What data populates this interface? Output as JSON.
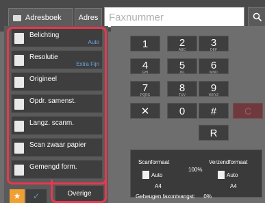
{
  "header": {
    "address_book_label": "Adresboek",
    "address_label": "Adres",
    "fax_placeholder": "Faxnummer"
  },
  "menu": [
    {
      "label": "Belichting",
      "value": "Auto",
      "icon": "exposure-icon"
    },
    {
      "label": "Resolutie",
      "value": "Extra Fijn",
      "icon": "resolution-icon"
    },
    {
      "label": "Origineel",
      "value": "",
      "icon": "original-icon"
    },
    {
      "label": "Opdr. samenst.",
      "value": "",
      "icon": "job-build-icon"
    },
    {
      "label": "Langz. scanm.",
      "value": "",
      "icon": "slow-scan-icon"
    },
    {
      "label": "Scan zwaar papier",
      "value": "",
      "icon": "thick-paper-icon"
    },
    {
      "label": "Gemengd form.",
      "value": "",
      "icon": "mixed-size-icon"
    }
  ],
  "footer_left": {
    "others_label": "Overige"
  },
  "keypad": [
    {
      "num": "1",
      "letters": ""
    },
    {
      "num": "2",
      "letters": "ABC"
    },
    {
      "num": "3",
      "letters": "DEF"
    },
    {
      "num": "4",
      "letters": "GHI"
    },
    {
      "num": "5",
      "letters": "JKL"
    },
    {
      "num": "6",
      "letters": "MNO"
    },
    {
      "num": "7",
      "letters": "PQRS"
    },
    {
      "num": "8",
      "letters": "TUV"
    },
    {
      "num": "9",
      "letters": "WXYZ"
    },
    {
      "num": "✕",
      "letters": ""
    },
    {
      "num": "0",
      "letters": ""
    },
    {
      "num": "#",
      "letters": ""
    },
    {
      "num": "R",
      "letters": ""
    }
  ],
  "clear_label": "C",
  "info": {
    "scan_size_label": "Scanformaat",
    "send_size_label": "Verzendformaat",
    "ratio": "100%",
    "scan_auto": "Auto",
    "scan_paper": "A4",
    "send_auto": "Auto",
    "send_paper": "A4"
  },
  "status": {
    "memory_text": "Geheugen faxontvangst:",
    "memory_value": "0%"
  },
  "colors": {
    "highlight": "#e8384f",
    "value_blue": "#6aa6e8",
    "star": "#f0a030"
  }
}
